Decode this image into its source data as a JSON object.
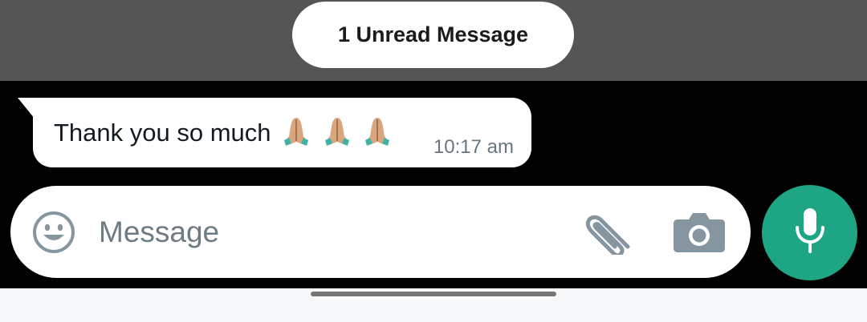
{
  "unread_banner": {
    "label": "1 Unread Message"
  },
  "message": {
    "text": "Thank you so much",
    "emoji": [
      "folded-hands-icon",
      "folded-hands-icon",
      "folded-hands-icon"
    ],
    "time": "10:17 am"
  },
  "composer": {
    "placeholder": "Message",
    "value": "",
    "icons": {
      "emoji": "smiley-icon",
      "attach": "paperclip-icon",
      "camera": "camera-icon",
      "send": "microphone-icon"
    }
  },
  "colors": {
    "chat_background": "#000000",
    "unread_band": "#555555",
    "bubble": "#ffffff",
    "accent": "#1ea584",
    "icon_gray": "#8696a0",
    "time_text": "#667781",
    "nav_bar": "#f7f8fa"
  }
}
